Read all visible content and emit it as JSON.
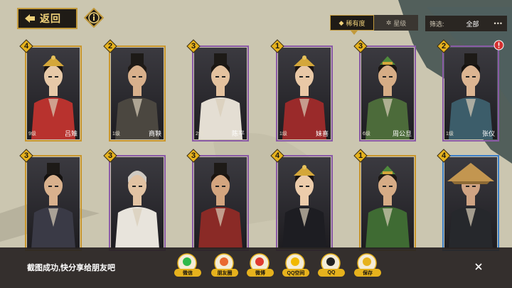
{
  "topbar": {
    "back_label": "返回"
  },
  "sort": {
    "tabs": [
      {
        "label": "稀有度",
        "active": true
      },
      {
        "label": "星级",
        "active": false
      }
    ]
  },
  "filter": {
    "label": "筛选:",
    "value": "全部",
    "more": "•••"
  },
  "cards": [
    {
      "name": "吕雉",
      "level": "9级",
      "rarity": "4",
      "frame": "#c9962c"
    },
    {
      "name": "商鞅",
      "level": "1级",
      "rarity": "2",
      "frame": "#c9962c"
    },
    {
      "name": "陈平",
      "level": "2级",
      "rarity": "3",
      "frame": "#8a5aa6"
    },
    {
      "name": "妹喜",
      "level": "1级",
      "rarity": "1",
      "frame": "#8a5aa6"
    },
    {
      "name": "周公旦",
      "level": "6级",
      "rarity": "3",
      "frame": "#8a5aa6"
    },
    {
      "name": "张仪",
      "level": "1级",
      "rarity": "2",
      "frame": "#8a5aa6",
      "alert": true
    },
    {
      "name": "",
      "level": "",
      "rarity": "3",
      "frame": "#c9962c"
    },
    {
      "name": "",
      "level": "",
      "rarity": "3",
      "frame": "#8a5aa6"
    },
    {
      "name": "",
      "level": "",
      "rarity": "3",
      "frame": "#8a5aa6"
    },
    {
      "name": "",
      "level": "",
      "rarity": "4",
      "frame": "#8a5aa6"
    },
    {
      "name": "",
      "level": "",
      "rarity": "1",
      "frame": "#c9962c"
    },
    {
      "name": "",
      "level": "",
      "rarity": "4",
      "frame": "#3c7fc9"
    }
  ],
  "share": {
    "message": "截图成功,快分享给朋友吧",
    "targets": [
      {
        "label": "微信",
        "icon": "wechat-icon"
      },
      {
        "label": "朋友圈",
        "icon": "moments-icon"
      },
      {
        "label": "微博",
        "icon": "weibo-icon"
      },
      {
        "label": "QQ空间",
        "icon": "qzone-icon"
      },
      {
        "label": "QQ",
        "icon": "qq-icon"
      },
      {
        "label": "保存",
        "icon": "save-icon"
      }
    ]
  },
  "colors": {
    "gold": "#c9962c",
    "purple": "#8a5aa6",
    "blue": "#3c7fc9",
    "accent_yellow": "#e6b21d"
  }
}
